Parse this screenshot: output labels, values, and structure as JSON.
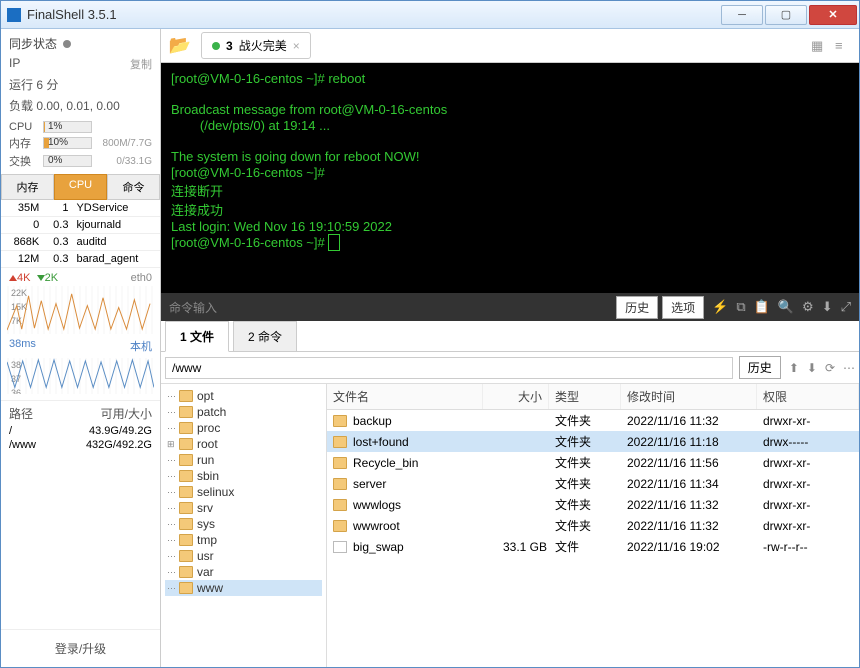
{
  "window": {
    "title": "FinalShell 3.5.1"
  },
  "sync": {
    "label": "同步状态"
  },
  "info": {
    "ipLabel": "IP",
    "copy": "复制",
    "uptime": "运行 6 分",
    "load": "负载 0.00, 0.01, 0.00"
  },
  "meters": {
    "cpu": {
      "label": "CPU",
      "pct": "1%",
      "fill": 1,
      "val": ""
    },
    "mem": {
      "label": "内存",
      "pct": "10%",
      "fill": 10,
      "val": "800M/7.7G"
    },
    "swap": {
      "label": "交换",
      "pct": "0%",
      "fill": 0,
      "val": "0/33.1G"
    }
  },
  "procTabs": {
    "mem": "内存",
    "cpu": "CPU",
    "cmd": "命令"
  },
  "procs": [
    {
      "mem": "35M",
      "cpu": "1",
      "cmd": "YDService"
    },
    {
      "mem": "0",
      "cpu": "0.3",
      "cmd": "kjournald"
    },
    {
      "mem": "868K",
      "cpu": "0.3",
      "cmd": "auditd"
    },
    {
      "mem": "12M",
      "cpu": "0.3",
      "cmd": "barad_agent"
    }
  ],
  "net": {
    "up": "4K",
    "dn": "2K",
    "iface": "eth0",
    "y": [
      "22K",
      "15K",
      "7K"
    ]
  },
  "ping": {
    "val": "38ms",
    "host": "本机",
    "y": [
      "38",
      "37",
      "36"
    ]
  },
  "diskHdr": {
    "path": "路径",
    "usage": "可用/大小"
  },
  "disks": [
    {
      "path": "/",
      "usage": "43.9G/49.2G"
    },
    {
      "path": "/www",
      "usage": "432G/492.2G"
    }
  ],
  "login": "登录/升级",
  "tab": {
    "num": "3",
    "name": "战火完美"
  },
  "view": {
    "grid": "▦",
    "list": "≡"
  },
  "term": {
    "l1": "[root@VM-0-16-centos ~]# reboot",
    "l2": "Broadcast message from root@VM-0-16-centos",
    "l3": "        (/dev/pts/0) at 19:14 ...",
    "l4": "The system is going down for reboot NOW!",
    "l5": "[root@VM-0-16-centos ~]#",
    "l6": "连接断开",
    "l7": "连接成功",
    "l8": "Last login: Wed Nov 16 19:10:59 2022",
    "l9": "[root@VM-0-16-centos ~]# "
  },
  "termbar": {
    "input": "命令输入",
    "history": "历史",
    "options": "选项"
  },
  "btabs": {
    "files": "1 文件",
    "cmds": "2 命令"
  },
  "path": "/www",
  "history": "历史",
  "tree": [
    "opt",
    "patch",
    "proc",
    "root",
    "run",
    "sbin",
    "selinux",
    "srv",
    "sys",
    "tmp",
    "usr",
    "var",
    "www"
  ],
  "cols": {
    "name": "文件名",
    "size": "大小",
    "type": "类型",
    "mtime": "修改时间",
    "perm": "权限"
  },
  "typeFolder": "文件夹",
  "typeFile": "文件",
  "files": [
    {
      "n": "backup",
      "s": "",
      "t": "文件夹",
      "m": "2022/11/16 11:32",
      "p": "drwxr-xr-",
      "f": true
    },
    {
      "n": "lost+found",
      "s": "",
      "t": "文件夹",
      "m": "2022/11/16 11:18",
      "p": "drwx-----",
      "f": true,
      "sel": true
    },
    {
      "n": "Recycle_bin",
      "s": "",
      "t": "文件夹",
      "m": "2022/11/16 11:56",
      "p": "drwxr-xr-",
      "f": true
    },
    {
      "n": "server",
      "s": "",
      "t": "文件夹",
      "m": "2022/11/16 11:34",
      "p": "drwxr-xr-",
      "f": true
    },
    {
      "n": "wwwlogs",
      "s": "",
      "t": "文件夹",
      "m": "2022/11/16 11:32",
      "p": "drwxr-xr-",
      "f": true
    },
    {
      "n": "wwwroot",
      "s": "",
      "t": "文件夹",
      "m": "2022/11/16 11:32",
      "p": "drwxr-xr-",
      "f": true
    },
    {
      "n": "big_swap",
      "s": "33.1 GB",
      "t": "文件",
      "m": "2022/11/16 19:02",
      "p": "-rw-r--r--",
      "f": false
    }
  ]
}
